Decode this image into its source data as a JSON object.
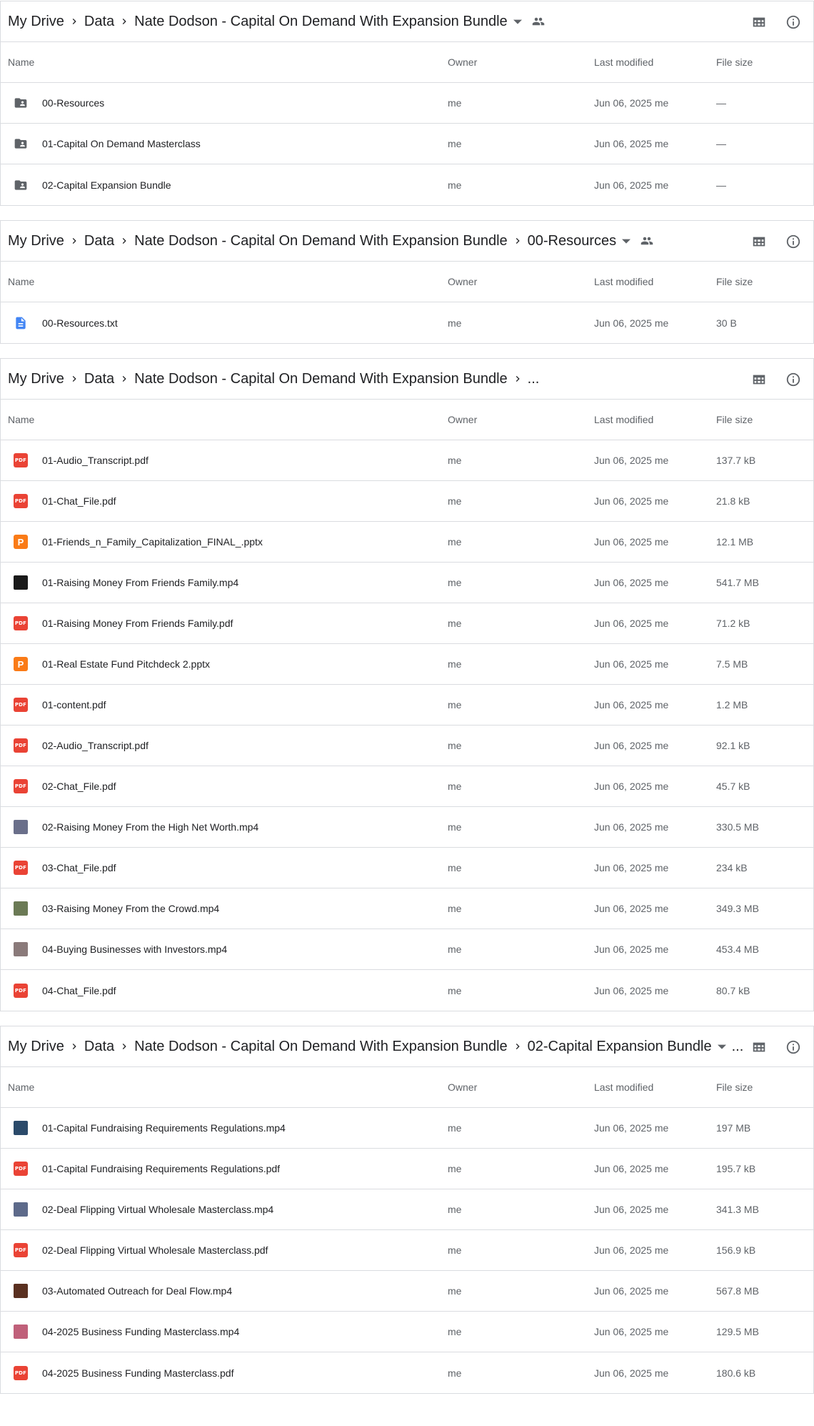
{
  "panels": [
    {
      "breadcrumb": [
        "My Drive",
        "Data",
        "Nate Dodson - Capital On Demand With Expansion Bundle"
      ],
      "trailing": "dropdown-shared",
      "columns": {
        "name": "Name",
        "owner": "Owner",
        "modified": "Last modified",
        "size": "File size"
      },
      "rows": [
        {
          "icon": "shared-folder-icon",
          "name": "00-Resources",
          "owner": "me",
          "modified": "Jun 06, 2025 me",
          "size": "—"
        },
        {
          "icon": "shared-folder-icon",
          "name": "01-Capital On Demand Masterclass",
          "owner": "me",
          "modified": "Jun 06, 2025 me",
          "size": "—"
        },
        {
          "icon": "shared-folder-icon",
          "name": "02-Capital Expansion Bundle",
          "owner": "me",
          "modified": "Jun 06, 2025 me",
          "size": "—"
        }
      ]
    },
    {
      "breadcrumb": [
        "My Drive",
        "Data",
        "Nate Dodson - Capital On Demand With Expansion Bundle",
        "00-Resources"
      ],
      "trailing": "dropdown-shared",
      "columns": {
        "name": "Name",
        "owner": "Owner",
        "modified": "Last modified",
        "size": "File size"
      },
      "rows": [
        {
          "icon": "doc-icon",
          "name": "00-Resources.txt",
          "owner": "me",
          "modified": "Jun 06, 2025 me",
          "size": "30 B"
        }
      ]
    },
    {
      "breadcrumb": [
        "My Drive",
        "Data",
        "Nate Dodson - Capital On Demand With Expansion Bundle"
      ],
      "trailing": "ellipsis",
      "ellipsis": "...",
      "columns": {
        "name": "Name",
        "owner": "Owner",
        "modified": "Last modified",
        "size": "File size"
      },
      "rows": [
        {
          "icon": "pdf-icon",
          "name": "01-Audio_Transcript.pdf",
          "owner": "me",
          "modified": "Jun 06, 2025 me",
          "size": "137.7 kB"
        },
        {
          "icon": "pdf-icon",
          "name": "01-Chat_File.pdf",
          "owner": "me",
          "modified": "Jun 06, 2025 me",
          "size": "21.8 kB"
        },
        {
          "icon": "pptx-icon",
          "name": "01-Friends_n_Family_Capitalization_FINAL_.pptx",
          "owner": "me",
          "modified": "Jun 06, 2025 me",
          "size": "12.1 MB"
        },
        {
          "icon": "video-thumb-icon",
          "thumb": "#1a1a1a",
          "name": "01-Raising Money From Friends Family.mp4",
          "owner": "me",
          "modified": "Jun 06, 2025 me",
          "size": "541.7 MB"
        },
        {
          "icon": "pdf-icon",
          "name": "01-Raising Money From Friends Family.pdf",
          "owner": "me",
          "modified": "Jun 06, 2025 me",
          "size": "71.2 kB"
        },
        {
          "icon": "pptx-icon",
          "name": "01-Real Estate Fund Pitchdeck 2.pptx",
          "owner": "me",
          "modified": "Jun 06, 2025 me",
          "size": "7.5 MB"
        },
        {
          "icon": "pdf-icon",
          "name": "01-content.pdf",
          "owner": "me",
          "modified": "Jun 06, 2025 me",
          "size": "1.2 MB"
        },
        {
          "icon": "pdf-icon",
          "name": "02-Audio_Transcript.pdf",
          "owner": "me",
          "modified": "Jun 06, 2025 me",
          "size": "92.1 kB"
        },
        {
          "icon": "pdf-icon",
          "name": "02-Chat_File.pdf",
          "owner": "me",
          "modified": "Jun 06, 2025 me",
          "size": "45.7 kB"
        },
        {
          "icon": "video-thumb-icon",
          "thumb": "#6a6f8a",
          "name": "02-Raising Money From the High Net Worth.mp4",
          "owner": "me",
          "modified": "Jun 06, 2025 me",
          "size": "330.5 MB"
        },
        {
          "icon": "pdf-icon",
          "name": "03-Chat_File.pdf",
          "owner": "me",
          "modified": "Jun 06, 2025 me",
          "size": "234 kB"
        },
        {
          "icon": "video-thumb-icon",
          "thumb": "#6b7a55",
          "name": "03-Raising Money From the Crowd.mp4",
          "owner": "me",
          "modified": "Jun 06, 2025 me",
          "size": "349.3 MB"
        },
        {
          "icon": "video-thumb-icon",
          "thumb": "#8a7a7a",
          "name": "04-Buying Businesses with Investors.mp4",
          "owner": "me",
          "modified": "Jun 06, 2025 me",
          "size": "453.4 MB"
        },
        {
          "icon": "pdf-icon",
          "name": "04-Chat_File.pdf",
          "owner": "me",
          "modified": "Jun 06, 2025 me",
          "size": "80.7 kB"
        }
      ]
    },
    {
      "breadcrumb": [
        "My Drive",
        "Data",
        "Nate Dodson - Capital On Demand With Expansion Bundle",
        "02-Capital Expansion Bundle"
      ],
      "trailing": "dropdown-ellipsis",
      "ellipsis": "...",
      "columns": {
        "name": "Name",
        "owner": "Owner",
        "modified": "Last modified",
        "size": "File size"
      },
      "rows": [
        {
          "icon": "video-thumb-icon",
          "thumb": "#2b4a6a",
          "name": "01-Capital Fundraising Requirements Regulations.mp4",
          "owner": "me",
          "modified": "Jun 06, 2025 me",
          "size": "197 MB"
        },
        {
          "icon": "pdf-icon",
          "name": "01-Capital Fundraising Requirements Regulations.pdf",
          "owner": "me",
          "modified": "Jun 06, 2025 me",
          "size": "195.7 kB"
        },
        {
          "icon": "video-thumb-icon",
          "thumb": "#5d6a8a",
          "name": "02-Deal Flipping Virtual Wholesale Masterclass.mp4",
          "owner": "me",
          "modified": "Jun 06, 2025 me",
          "size": "341.3 MB"
        },
        {
          "icon": "pdf-icon",
          "name": "02-Deal Flipping Virtual Wholesale Masterclass.pdf",
          "owner": "me",
          "modified": "Jun 06, 2025 me",
          "size": "156.9 kB"
        },
        {
          "icon": "video-thumb-icon",
          "thumb": "#5a3020",
          "name": "03-Automated Outreach for Deal Flow.mp4",
          "owner": "me",
          "modified": "Jun 06, 2025 me",
          "size": "567.8 MB"
        },
        {
          "icon": "video-thumb-icon",
          "thumb": "#c0607a",
          "name": "04-2025 Business Funding Masterclass.mp4",
          "owner": "me",
          "modified": "Jun 06, 2025 me",
          "size": "129.5 MB"
        },
        {
          "icon": "pdf-icon",
          "name": "04-2025 Business Funding Masterclass.pdf",
          "owner": "me",
          "modified": "Jun 06, 2025 me",
          "size": "180.6 kB"
        }
      ]
    }
  ],
  "icons": {
    "grid": "grid-view-icon",
    "info": "info-icon",
    "pdf_label": "PDF",
    "pptx_label": "P"
  },
  "colors": {
    "pdf": "#ea4335",
    "pptx": "#fa7b17",
    "doc": "#4285f4",
    "folder": "#5f6368",
    "border": "#dadce0"
  }
}
